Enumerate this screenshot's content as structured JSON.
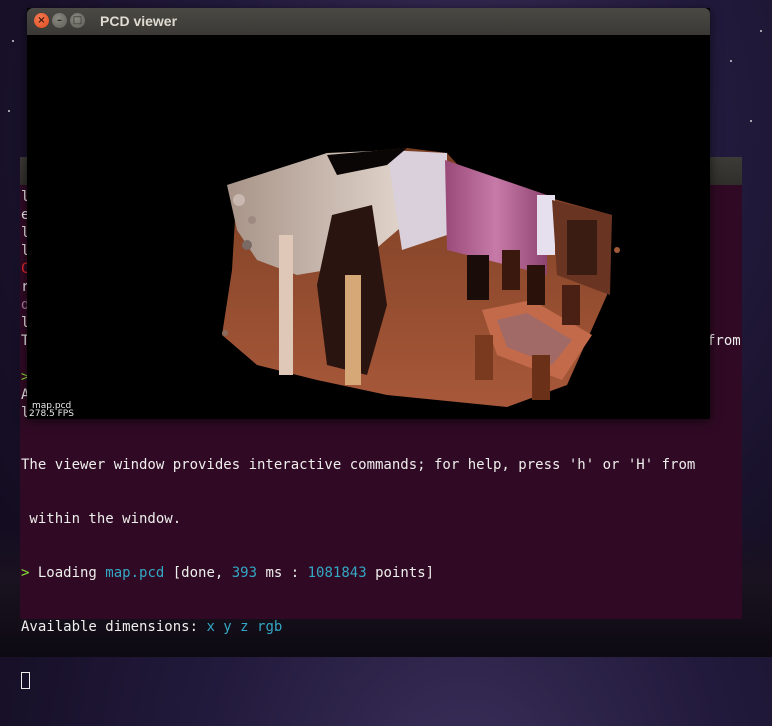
{
  "viewer": {
    "title": "PCD viewer",
    "close_glyph": "×",
    "min_glyph": "–",
    "max_glyph": "□",
    "cloud_name": "map.pcd",
    "fps": "278.5 FPS"
  },
  "terminal": {
    "left_glyphs": [
      "l",
      "e",
      "l",
      "l",
      "C",
      "r",
      "d",
      "l",
      "T",
      "",
      "",
      ">",
      "A",
      "l"
    ],
    "right_glyph": "from",
    "lines": [
      {
        "plain": "The viewer window provides interactive commands; for help, press 'h' or 'H' from"
      },
      {
        "plain": " within the window."
      },
      {
        "prompt": "> ",
        "t1": "Loading ",
        "file": "map.pcd",
        "t2": " [done, ",
        "ms": "393",
        "t3": " ms : ",
        "points": "1081843",
        "t4": " points]"
      },
      {
        "t1": "Available dimensions: ",
        "dims": "x y z rgb"
      }
    ]
  },
  "colors": {
    "terminal_bg": "#300a24",
    "prompt": "#8ae234",
    "highlight": "#34a7c4",
    "close_button": "#de4a1c"
  }
}
